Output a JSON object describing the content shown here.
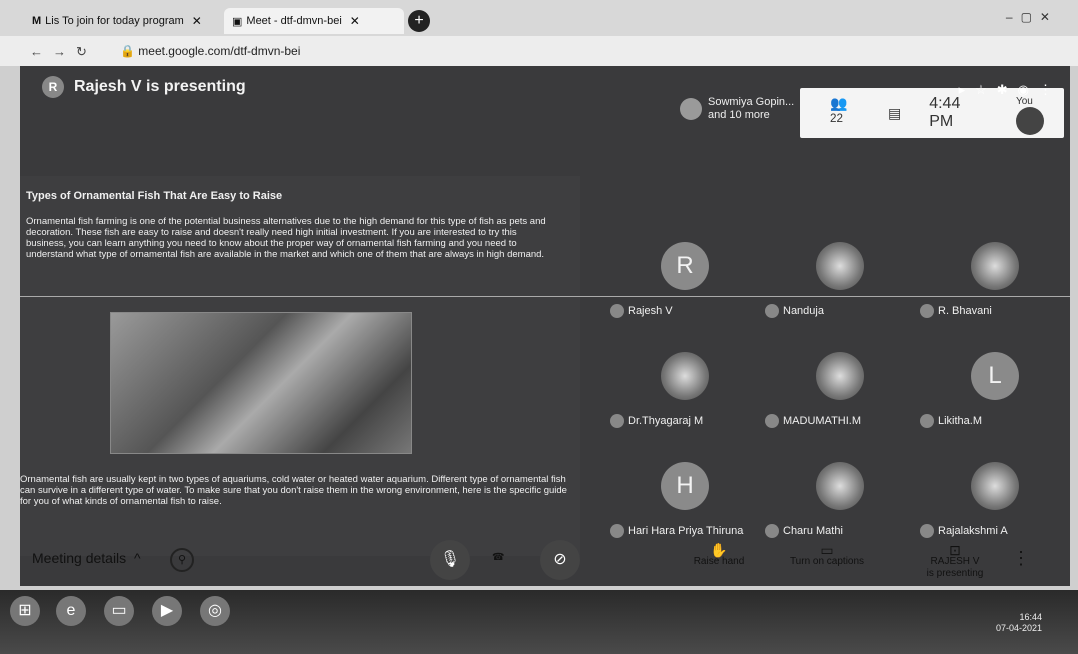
{
  "browser": {
    "tabs": [
      {
        "title": "Lis To join for today program",
        "icon": "gmail-icon"
      },
      {
        "title": "Meet - dtf-dmvn-bei",
        "icon": "meet-icon"
      }
    ],
    "url": "meet.google.com/dtf-dmvn-bei"
  },
  "meet": {
    "presenter_text": "Rajesh V is presenting",
    "presenter_initial": "R",
    "people_chip": {
      "line1": "Sowmiya Gopin...",
      "line2": "and 10 more"
    },
    "people_count": "22",
    "clock": "4:44 PM",
    "you_label": "You"
  },
  "doc": {
    "title": "Types of Ornamental Fish That Are Easy to Raise",
    "para1": "Ornamental fish farming is one of the potential business alternatives due to the high demand for this type of fish as pets and decoration. These fish are easy to raise and doesn't really need high initial investment. If you are interested to try this business, you can learn anything you need to know about the proper way of ornamental fish farming and you need to understand what type of ornamental fish are available in the market and which one of them that are always in high demand.",
    "para2": "Ornamental fish are usually kept in two types of aquariums, cold water or heated water aquarium. Different type of ornamental fish can survive in a different type of water. To make sure that you don't raise them in the wrong environment, here is the specific guide for you of what kinds of ornamental fish to raise."
  },
  "participants": [
    {
      "name": "Rajesh V",
      "initial": "R",
      "photo": false
    },
    {
      "name": "Nanduja",
      "initial": "",
      "photo": true
    },
    {
      "name": "R. Bhavani",
      "initial": "",
      "photo": true
    },
    {
      "name": "Dr.Thyagaraj M",
      "initial": "",
      "photo": true
    },
    {
      "name": "MADUMATHI.M",
      "initial": "",
      "photo": true
    },
    {
      "name": "Likitha.M",
      "initial": "L",
      "photo": false
    },
    {
      "name": "Hari Hara Priya Thiruna",
      "initial": "H",
      "photo": false
    },
    {
      "name": "Charu Mathi",
      "initial": "",
      "photo": true
    },
    {
      "name": "Rajalakshmi A",
      "initial": "",
      "photo": true
    }
  ],
  "controls": {
    "meeting_details": "Meeting details",
    "raise_hand": "Raise hand",
    "captions": "Turn on captions",
    "presenting_line1": "RAJESH V",
    "presenting_line2": "is presenting"
  },
  "taskbar": {
    "time": "16:44",
    "date": "07-04-2021"
  }
}
